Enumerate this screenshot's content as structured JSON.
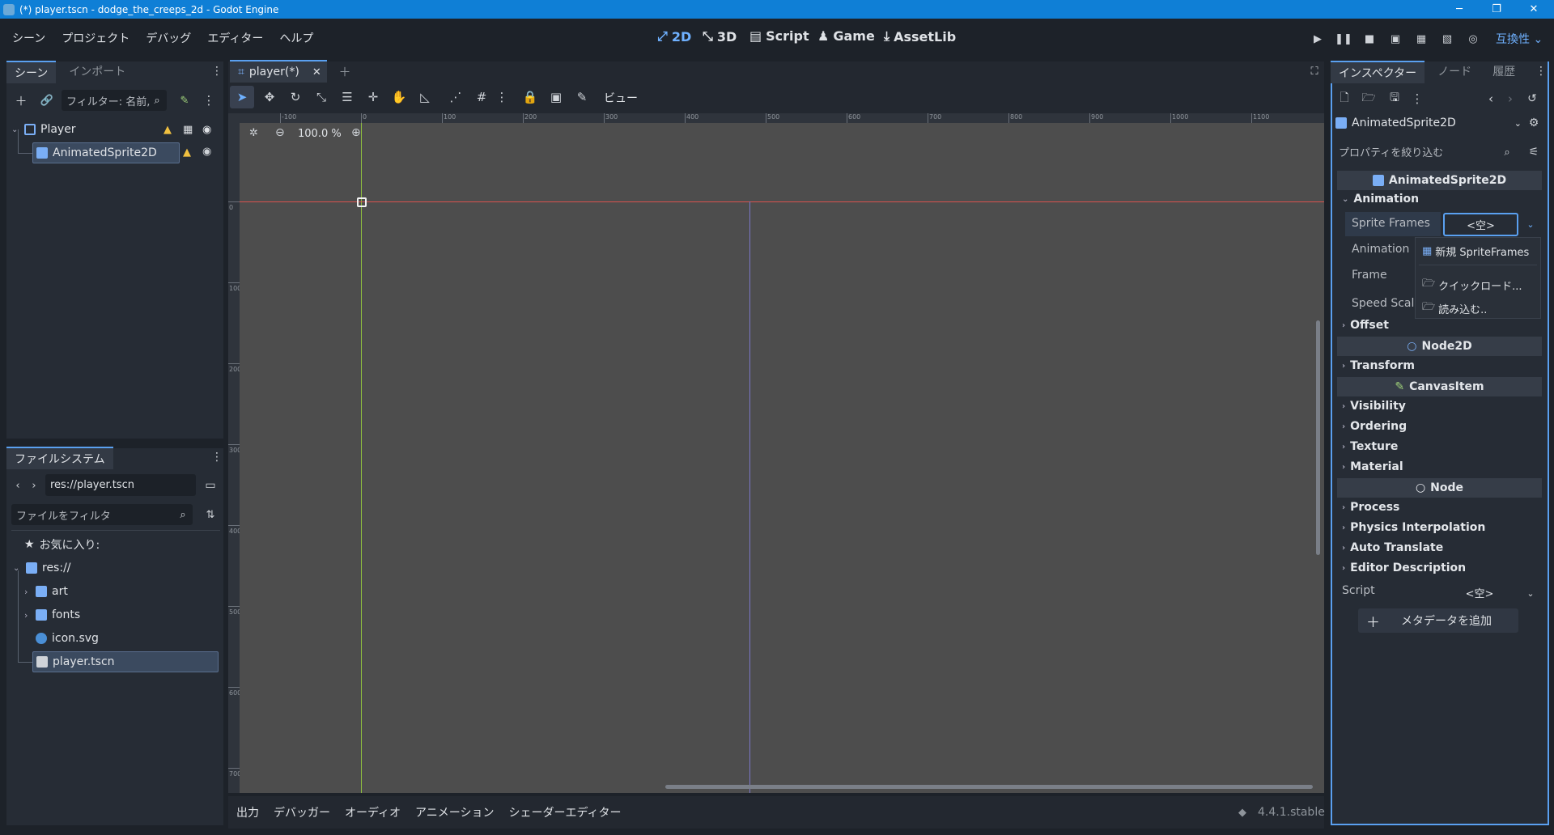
{
  "window": {
    "title": "(*) player.tscn - dodge_the_creeps_2d - Godot Engine",
    "minimize": "─",
    "restore": "❐",
    "close": "✕"
  },
  "menus": [
    "シーン",
    "プロジェクト",
    "デバッグ",
    "エディター",
    "ヘルプ"
  ],
  "workspaces": {
    "w2d": "2D",
    "w3d": "3D",
    "script": "Script",
    "game": "Game",
    "assetlib": "AssetLib"
  },
  "renderer": "互換性",
  "scene_panel": {
    "tabs": [
      "シーン",
      "インポート"
    ],
    "filter_placeholder": "フィルター: 名前,",
    "nodes": [
      {
        "name": "Player",
        "icon": "node2d-icon"
      },
      {
        "name": "AnimatedSprite2D",
        "icon": "animated-sprite-icon"
      }
    ]
  },
  "filesystem": {
    "tab": "ファイルシステム",
    "path": "res://player.tscn",
    "filter_placeholder": "ファイルをフィルタ",
    "items": [
      {
        "label": "お気に入り:"
      },
      {
        "label": "res://"
      },
      {
        "label": "art"
      },
      {
        "label": "fonts"
      },
      {
        "label": "icon.svg"
      },
      {
        "label": "player.tscn"
      }
    ]
  },
  "editor": {
    "tab": "player(*)",
    "view_menu": "ビュー",
    "zoom": "100.0 %",
    "ruler_x": [
      "-100",
      "0",
      "100",
      "200",
      "300",
      "400",
      "500",
      "600",
      "700",
      "800",
      "900",
      "1000",
      "1100"
    ],
    "ruler_y": [
      "0",
      "100",
      "200",
      "300",
      "400",
      "500",
      "600",
      "700"
    ]
  },
  "bottom_tabs": [
    "出力",
    "デバッガー",
    "オーディオ",
    "アニメーション",
    "シェーダーエディター"
  ],
  "version": "4.4.1.stable",
  "inspector": {
    "tabs": [
      "インスペクター",
      "ノード",
      "履歴"
    ],
    "object": "AnimatedSprite2D",
    "filter_placeholder": "プロパティを絞り込む",
    "class_header": "AnimatedSprite2D",
    "animation_cat": "Animation",
    "props": {
      "sprite_frames": "Sprite Frames",
      "sprite_frames_value": "<空>",
      "animation": "Animation",
      "frame": "Frame",
      "speed_scale": "Speed Scale"
    },
    "cats": {
      "offset": "Offset",
      "transform": "Transform",
      "visibility": "Visibility",
      "ordering": "Ordering",
      "texture": "Texture",
      "material": "Material",
      "process": "Process",
      "physics": "Physics Interpolation",
      "auto_translate": "Auto Translate",
      "editor_desc": "Editor Description"
    },
    "sections": {
      "node2d": "Node2D",
      "canvasitem": "CanvasItem",
      "node": "Node"
    },
    "script_label": "Script",
    "script_value": "<空>",
    "add_metadata": "メタデータを追加"
  },
  "popup": {
    "new_item": "新規 SpriteFrames",
    "quickload": "クイックロード...",
    "load": "読み込む.."
  },
  "colors": {
    "accent": "#5aa0f0",
    "titlebar": "#0f7fd6",
    "warning": "#f0c040",
    "origin_x": "#d9534f",
    "origin_y": "#8fbf3f"
  }
}
